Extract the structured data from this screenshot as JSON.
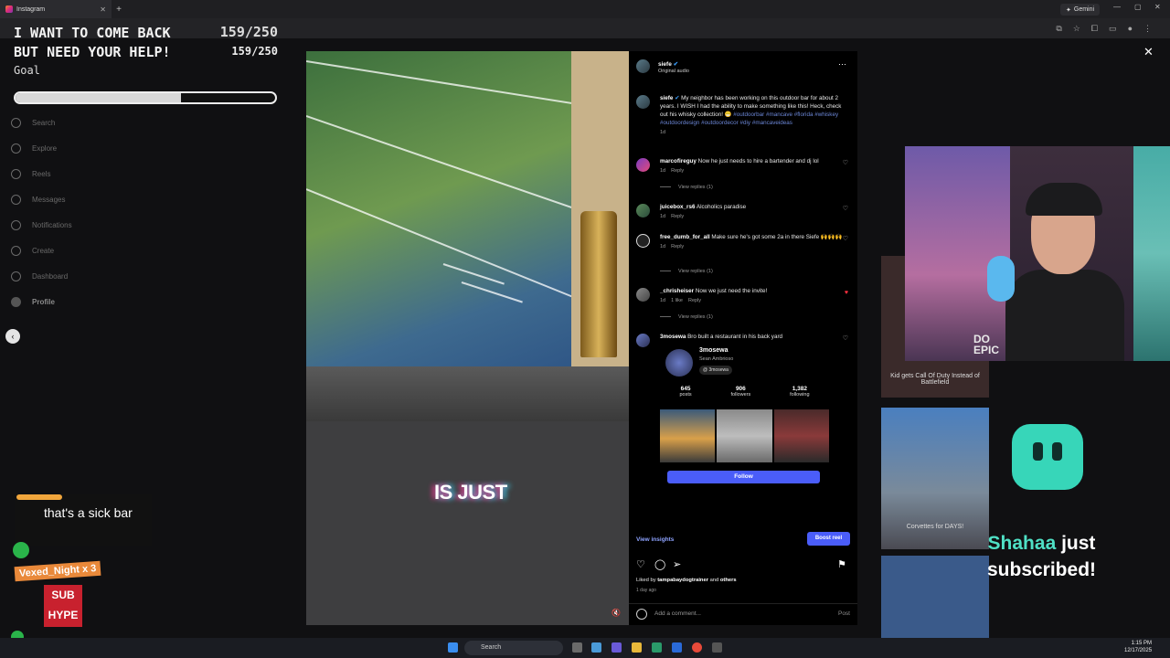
{
  "browser": {
    "tab_title": "Instagram",
    "gemini_label": "Gemini"
  },
  "instagram_nav": {
    "items": [
      "Search",
      "Explore",
      "Reels",
      "Messages",
      "Notifications",
      "Create",
      "Dashboard",
      "Profile"
    ]
  },
  "goal": {
    "title": "I WANT TO COME BACK\nBUT NEED YOUR HELP!",
    "count_main": "159/250",
    "count_sub": "159/250",
    "label": "Goal",
    "progress_fraction": 0.636
  },
  "video": {
    "caption": "IS JUST"
  },
  "post": {
    "username": "siefe",
    "audio": "Original audio",
    "caption_text": "My neighbor has been working on this outdoor bar for about 2 years. I WISH I had the ability to make something like this! Heck, check out his whisky collection! 😁",
    "caption_tags": "#outdoorbar #mancave #florida #whiskey #outdoordesign #outdoordecor #diy #mancaveideas",
    "caption_time": "1d"
  },
  "comments": [
    {
      "user": "marcofireguy",
      "text": "Now he just needs to hire a bartender and dj lol",
      "time": "1d",
      "reply": "Reply",
      "likes": "",
      "view_replies": "View replies (1)"
    },
    {
      "user": "juicebox_rs6",
      "text": "Alcoholics paradise",
      "time": "1d",
      "reply": "Reply",
      "likes": "",
      "view_replies": ""
    },
    {
      "user": "free_dumb_for_all",
      "text": "Make sure he's got some 2a in there Siefe 🙌🙌🙌",
      "time": "1d",
      "reply": "Reply",
      "likes": "",
      "view_replies": "View replies (1)"
    },
    {
      "user": "_chrisheiser",
      "text": "Now we just need the invite!",
      "time": "1d",
      "reply": "Reply",
      "likes": "1 like",
      "view_replies": "View replies (1)"
    },
    {
      "user": "3mosewa",
      "text": "Bro built a restaurant in his back yard",
      "time": "",
      "reply": "",
      "likes": "",
      "view_replies": ""
    }
  ],
  "profile_card": {
    "username": "3mosewa",
    "full_name": "Sean Ambriosо",
    "threads": "3mosewa",
    "stats": [
      {
        "n": "645",
        "l": "posts"
      },
      {
        "n": "906",
        "l": "followers"
      },
      {
        "n": "1,382",
        "l": "following"
      }
    ],
    "follow_label": "Follow"
  },
  "footer": {
    "insights": "View insights",
    "boost": "Boost reel",
    "liked_prefix": "Liked by",
    "liked_user": "tampabaydogtrainer",
    "liked_and": "and",
    "liked_others": "others",
    "ago": "1 day ago",
    "add_comment": "Add a comment...",
    "post": "Post"
  },
  "background_posts": {
    "caption1": "Kid gets Call Of Duty Instead of Battlefield",
    "caption2": "Corvettes for DAYS!"
  },
  "webcam": {
    "shirt_text": "DO\nEPIC"
  },
  "sub_alert": {
    "name": "Shahaa",
    "text": "just subscribed!"
  },
  "chat": {
    "message": "that's a sick bar",
    "vexed": "Vexed_Night x 3",
    "subhype": "SUB HYPE"
  },
  "taskbar": {
    "search": "Search",
    "time": "1:15 PM",
    "date": "12/17/2025"
  },
  "colors": {
    "accent_blue": "#4a5df9",
    "twitch_teal": "#37d6b9",
    "like_red": "#ff3040"
  }
}
